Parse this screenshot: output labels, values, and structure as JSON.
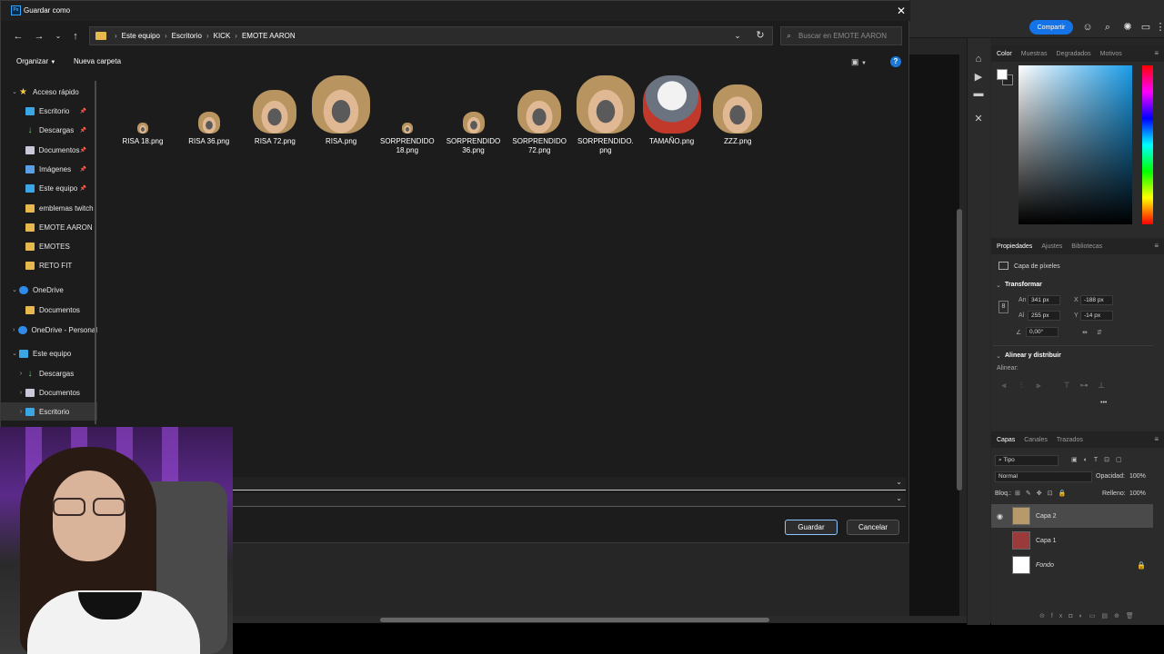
{
  "dialog": {
    "title": "Guardar como",
    "title_icon": "Ps",
    "close_glyph": "✕",
    "address": [
      "Este equipo",
      "Escritorio",
      "KICK",
      "EMOTE AARON"
    ],
    "search_placeholder": "Buscar en EMOTE AARON",
    "organize_label": "Organizar",
    "new_folder_label": "Nueva carpeta",
    "save_label": "Guardar",
    "cancel_label": "Cancelar"
  },
  "nav": [
    {
      "label": "Acceso rápido",
      "icon": "star-icon",
      "level": 0,
      "chevron": "⌄"
    },
    {
      "label": "Escritorio",
      "icon": "desktop-icon",
      "level": 1,
      "pin": true
    },
    {
      "label": "Descargas",
      "icon": "download-icon",
      "level": 1,
      "pin": true
    },
    {
      "label": "Documentos",
      "icon": "document-icon",
      "level": 1,
      "pin": true
    },
    {
      "label": "Imágenes",
      "icon": "image-icon",
      "level": 1,
      "pin": true
    },
    {
      "label": "Este equipo",
      "icon": "pc-icon",
      "level": 1,
      "pin": true
    },
    {
      "label": "emblemas twitch",
      "icon": "folder-icon",
      "level": 1
    },
    {
      "label": "EMOTE AARON",
      "icon": "folder-icon",
      "level": 1
    },
    {
      "label": "EMOTES",
      "icon": "folder-icon",
      "level": 1
    },
    {
      "label": "RETO FIT",
      "icon": "folder-icon",
      "level": 1
    },
    {
      "label": "OneDrive",
      "icon": "cloud-icon",
      "level": 0,
      "chevron": "⌄"
    },
    {
      "label": "Documentos",
      "icon": "folder-icon",
      "level": 1
    },
    {
      "label": "OneDrive - Personal",
      "icon": "cloud-icon",
      "level": 0,
      "chevron": "›"
    },
    {
      "label": "Este equipo",
      "icon": "pc-icon",
      "level": 0,
      "chevron": "⌄"
    },
    {
      "label": "Descargas",
      "icon": "download-icon",
      "level": 1,
      "chevron": "›"
    },
    {
      "label": "Documentos",
      "icon": "document-icon",
      "level": 1,
      "chevron": "›"
    },
    {
      "label": "Escritorio",
      "icon": "desktop-icon",
      "level": 1,
      "chevron": "›",
      "selected": true
    }
  ],
  "files": [
    {
      "name": "RISA 18.png",
      "type": "soldier-laugh"
    },
    {
      "name": "RISA 36.png",
      "type": "soldier-laugh"
    },
    {
      "name": "RISA 72.png",
      "type": "soldier-laugh"
    },
    {
      "name": "RISA.png",
      "type": "soldier-laugh"
    },
    {
      "name": "SORPRENDIDO 18.png",
      "type": "soldier-surprised"
    },
    {
      "name": "SORPRENDIDO 36.png",
      "type": "soldier-surprised"
    },
    {
      "name": "SORPRENDIDO 72.png",
      "type": "soldier-surprised"
    },
    {
      "name": "SORPRENDIDO.png",
      "type": "soldier-surprised"
    },
    {
      "name": "TAMAÑO.png",
      "type": "dog"
    },
    {
      "name": "ZZZ.png",
      "type": "soldier-sleep"
    }
  ],
  "photoshop": {
    "share_label": "Compartir",
    "color_tabs": [
      "Color",
      "Muestras",
      "Degradados",
      "Motivos"
    ],
    "props_tabs": [
      "Propiedades",
      "Ajustes",
      "Bibliotecas"
    ],
    "pixel_layer_label": "Capa de píxeles",
    "transform_label": "Transformar",
    "width_label": "An",
    "width_value": "341 px",
    "height_label": "Al",
    "height_value": "255 px",
    "x_label": "X",
    "x_value": "-188 px",
    "y_label": "Y",
    "y_value": "-14 px",
    "angle_value": "0,00°",
    "align_label": "Alinear y distribuir",
    "align_sub": "Alinear:",
    "more_glyph": "•••",
    "layers_tabs": [
      "Capas",
      "Canales",
      "Trazados"
    ],
    "filter_label": "Tipo",
    "blend_mode": "Normal",
    "opacity_label": "Opacidad:",
    "opacity_value": "100%",
    "lock_label": "Bloq.:",
    "fill_label": "Relleno:",
    "fill_value": "100%",
    "layers": [
      "Capa 2",
      "Capa 1",
      "Fondo"
    ],
    "colors": {
      "accent": "#1473e6",
      "picker_hue": "#1a9ce8"
    }
  }
}
